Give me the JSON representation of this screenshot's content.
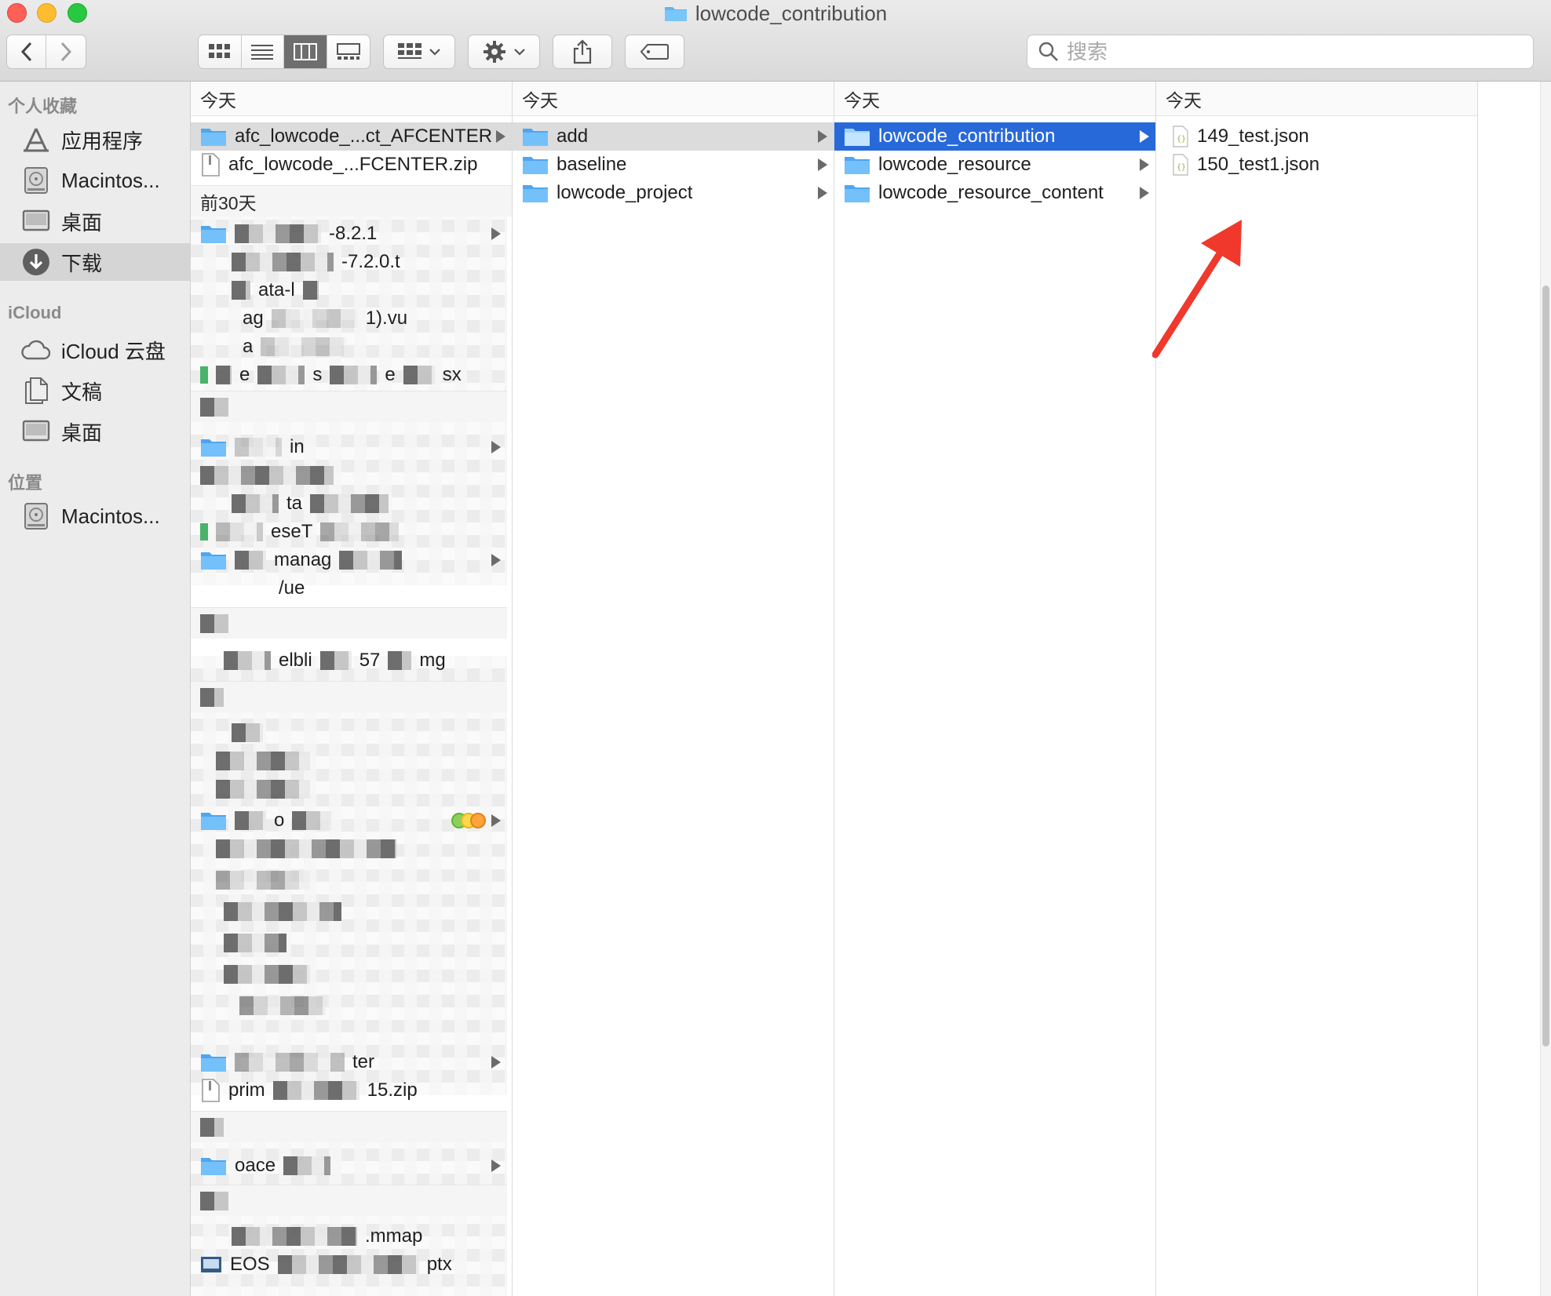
{
  "window": {
    "title": "lowcode_contribution"
  },
  "toolbar": {
    "back_icon": "chevron-left-icon",
    "forward_icon": "chevron-right-icon",
    "view_modes": [
      "icon-view-icon",
      "list-view-icon",
      "column-view-icon",
      "gallery-view-icon"
    ],
    "active_view": "column-view-icon",
    "group_icon": "group-icon",
    "action_icon": "gear-icon",
    "share_icon": "share-icon",
    "tag_icon": "tag-icon"
  },
  "search": {
    "placeholder": "搜索",
    "value": ""
  },
  "sidebar": {
    "sections": [
      {
        "title": "个人收藏",
        "items": [
          {
            "label": "应用程序",
            "icon": "applications-icon"
          },
          {
            "label": "Macintos...",
            "icon": "hard-drive-icon"
          },
          {
            "label": "桌面",
            "icon": "desktop-icon"
          },
          {
            "label": "下载",
            "icon": "download-icon",
            "selected": true
          }
        ]
      },
      {
        "title": "iCloud",
        "items": [
          {
            "label": "iCloud 云盘",
            "icon": "cloud-icon"
          },
          {
            "label": "文稿",
            "icon": "documents-icon"
          },
          {
            "label": "桌面",
            "icon": "desktop-icon"
          }
        ]
      },
      {
        "title": "位置",
        "items": [
          {
            "label": "Macintos...",
            "icon": "hard-drive-icon"
          }
        ]
      }
    ]
  },
  "columns": [
    {
      "header": "今天",
      "rows": [
        {
          "name": "afc_lowcode_...ct_AFCENTER",
          "type": "folder",
          "selected": "grey",
          "chevron": true
        },
        {
          "name": "afc_lowcode_...FCENTER.zip",
          "type": "zip"
        }
      ],
      "group2": {
        "header": "前30天"
      },
      "fragments": {
        "r1": "-8.2.1",
        "r2": "-7.2.0.t",
        "r3": "ata-l",
        "r4": "ag",
        "r4b": "1).vu",
        "r5": "a",
        "r6": "e",
        "r6b": "s",
        "r6c": "e",
        "r6d": "sx",
        "r7": "in",
        "r8": "ta",
        "r9": "eseT",
        "r10": "manag",
        "r11": "/ue",
        "r12": "elbli",
        "r12b": "57",
        "r12c": "mg",
        "r13": "o",
        "r14": "ter",
        "r15": "prim",
        "r15b": "15.zip",
        "r16": "oace",
        "r17": ".mmap",
        "r18": "EOS",
        "r18b": "ptx"
      }
    },
    {
      "header": "今天",
      "rows": [
        {
          "name": "add",
          "type": "folder",
          "selected": "grey",
          "chevron": true
        },
        {
          "name": "baseline",
          "type": "folder",
          "chevron": true
        },
        {
          "name": "lowcode_project",
          "type": "folder",
          "chevron": true
        }
      ]
    },
    {
      "header": "今天",
      "rows": [
        {
          "name": "lowcode_contribution",
          "type": "folder",
          "selected": "blue",
          "chevron": true
        },
        {
          "name": "lowcode_resource",
          "type": "folder",
          "chevron": true
        },
        {
          "name": "lowcode_resource_content",
          "type": "folder",
          "chevron": true
        }
      ]
    },
    {
      "header": "今天",
      "rows": [
        {
          "name": "149_test.json",
          "type": "json"
        },
        {
          "name": "150_test1.json",
          "type": "json"
        }
      ]
    }
  ],
  "colors": {
    "selection_blue": "#2869d9",
    "folder_blue": "#5fb4f5",
    "annotation_red": "#f0382c"
  }
}
